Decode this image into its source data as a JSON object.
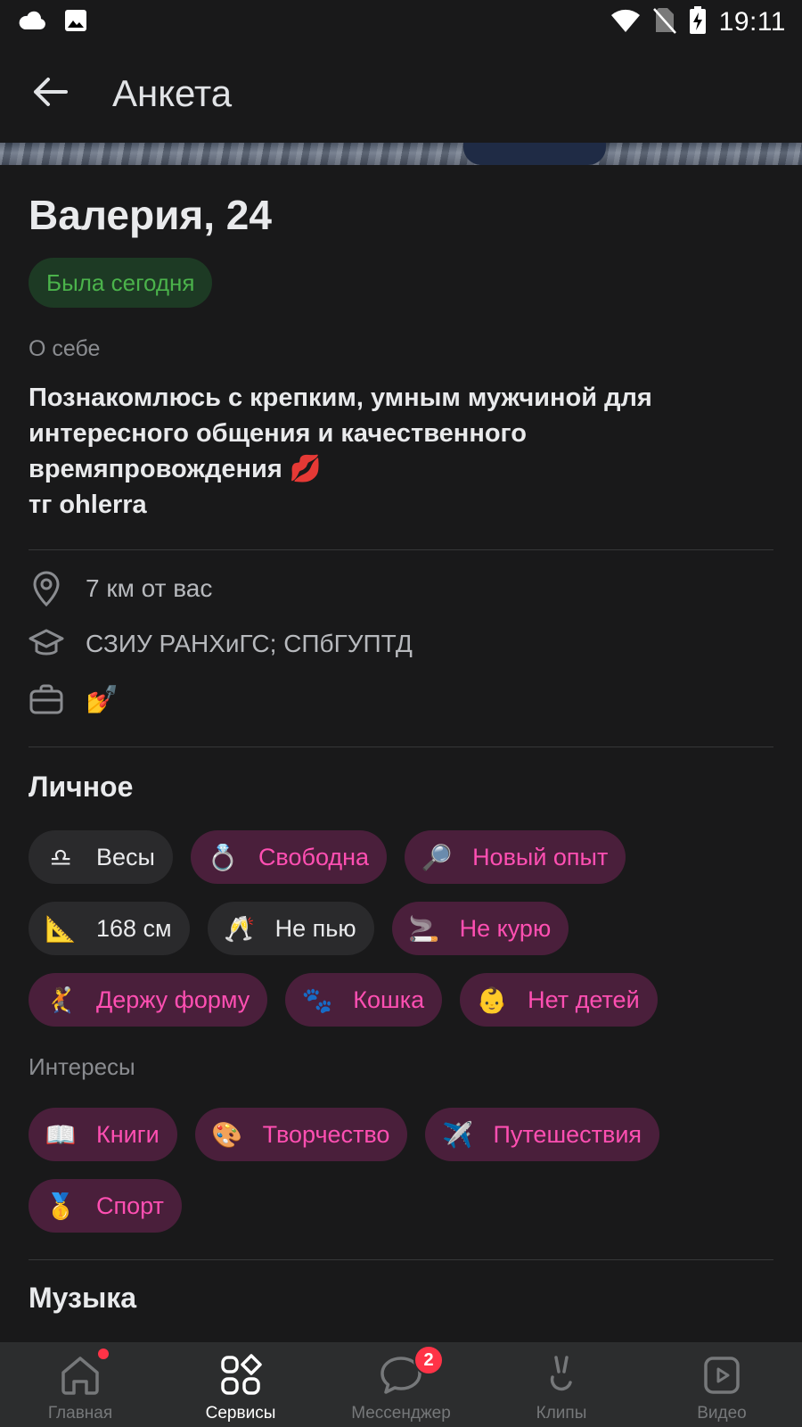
{
  "status_bar": {
    "time": "19:11",
    "left_icons": [
      "cloud-icon",
      "image-icon"
    ],
    "right_icons": [
      "wifi-icon",
      "no-sim-icon",
      "battery-charging-icon"
    ]
  },
  "header": {
    "title": "Анкета",
    "back_icon": "arrow-left-icon"
  },
  "profile": {
    "name": "Валерия, 24",
    "online_status": "Была сегодня",
    "about_caption": "О себе",
    "about_text": "Познакомлюсь с крепким, умным мужчиной для интересного общения и качественного времяпровождения 💋\nтг ohlerra"
  },
  "info": {
    "distance": "7 км от вас",
    "education": "СЗИУ РАНХиГС; СПбГУПТД",
    "work": "💅"
  },
  "personal": {
    "title": "Личное",
    "chips": [
      {
        "emoji": "♎",
        "label": "Весы",
        "match": false
      },
      {
        "emoji": "💍",
        "label": "Свободна",
        "match": true
      },
      {
        "emoji": "🔎",
        "label": "Новый опыт",
        "match": true
      },
      {
        "emoji": "📐",
        "label": "168 см",
        "match": false
      },
      {
        "emoji": "🥂",
        "label": "Не пью",
        "match": false
      },
      {
        "emoji": "🚬",
        "label": "Не курю",
        "match": true
      },
      {
        "emoji": "🤾",
        "label": "Держу форму",
        "match": true
      },
      {
        "emoji": "🐾",
        "label": "Кошка",
        "match": true
      },
      {
        "emoji": "👶",
        "label": "Нет детей",
        "match": true
      }
    ]
  },
  "interests": {
    "caption": "Интересы",
    "chips": [
      {
        "emoji": "📖",
        "label": "Книги",
        "match": true
      },
      {
        "emoji": "🎨",
        "label": "Творчество",
        "match": true
      },
      {
        "emoji": "✈️",
        "label": "Путешествия",
        "match": true
      },
      {
        "emoji": "🥇",
        "label": "Спорт",
        "match": true
      }
    ]
  },
  "music": {
    "title": "Музыка"
  },
  "bottom_nav": {
    "items": [
      {
        "label": "Главная",
        "icon": "home-icon",
        "active": false,
        "dot": true
      },
      {
        "label": "Сервисы",
        "icon": "services-icon",
        "active": true
      },
      {
        "label": "Мессенджер",
        "icon": "messenger-icon",
        "active": false,
        "badge": "2"
      },
      {
        "label": "Клипы",
        "icon": "clips-icon",
        "active": false
      },
      {
        "label": "Видео",
        "icon": "video-icon",
        "active": false
      }
    ]
  },
  "colors": {
    "background": "#19191a",
    "accent_pink": "#ff4fb2",
    "chip_match_bg": "#4a1f3b",
    "online_green": "#4bb34b",
    "badge_red": "#ff3347"
  }
}
